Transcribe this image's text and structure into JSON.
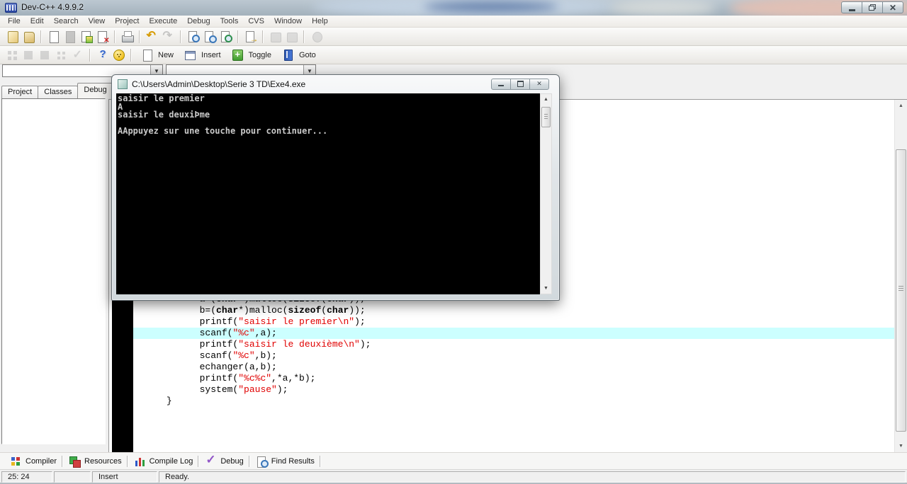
{
  "window": {
    "title": "Dev-C++ 4.9.9.2"
  },
  "menu": {
    "items": [
      "File",
      "Edit",
      "Search",
      "View",
      "Project",
      "Execute",
      "Debug",
      "Tools",
      "CVS",
      "Window",
      "Help"
    ]
  },
  "toolbar": {
    "row1": [
      {
        "icon": "new-project"
      },
      {
        "icon": "open-project"
      },
      "sep",
      {
        "icon": "new-source-file"
      },
      {
        "icon": "save",
        "disabled": true
      },
      {
        "icon": "save-all"
      },
      {
        "icon": "close-file"
      },
      "sep",
      {
        "icon": "print"
      },
      "sep",
      {
        "icon": "undo"
      },
      {
        "icon": "redo",
        "disabled": true
      },
      "sep",
      {
        "icon": "find"
      },
      {
        "icon": "find-in-files"
      },
      {
        "icon": "replace"
      },
      "sep",
      {
        "icon": "goto-line"
      },
      "sep",
      {
        "icon": "compile",
        "disabled": true
      },
      {
        "icon": "run",
        "disabled": true
      },
      "sep",
      {
        "icon": "profile",
        "disabled": true
      }
    ],
    "row2": [
      {
        "icon": "grid-squares",
        "disabled": true
      },
      {
        "icon": "square-a",
        "disabled": true
      },
      {
        "icon": "square-b",
        "disabled": true
      },
      {
        "icon": "grid-small",
        "disabled": true
      },
      {
        "icon": "check",
        "disabled": true
      },
      "sep",
      {
        "icon": "help"
      },
      {
        "icon": "about"
      },
      "sep",
      {
        "icon": "page",
        "label": "New"
      },
      {
        "icon": "insert-win",
        "label": "Insert"
      },
      {
        "icon": "toggle-plus",
        "label": "Toggle"
      },
      {
        "icon": "goto-book",
        "label": "Goto"
      }
    ]
  },
  "combos": {
    "class_combo_value": "",
    "member_combo_value": ""
  },
  "sidebar": {
    "tabs": [
      "Project",
      "Classes",
      "Debug"
    ],
    "active_tab": "Debug"
  },
  "console": {
    "title": "C:\\Users\\Admin\\Desktop\\Serie 3 TD\\Exe4.exe",
    "lines": [
      "saisir le premier",
      "A",
      "saisir le deuxiÞme",
      "",
      "AAppuyez sur une touche pour continuer..."
    ]
  },
  "editor": {
    "highlight_index": 3,
    "lines": [
      {
        "indent": 12,
        "tokens": [
          {
            "t": "p",
            "v": "a=("
          },
          {
            "t": "k",
            "v": "char"
          },
          {
            "t": "p",
            "v": "*)malloc("
          },
          {
            "t": "k",
            "v": "sizeof"
          },
          {
            "t": "p",
            "v": "("
          },
          {
            "t": "k",
            "v": "char"
          },
          {
            "t": "p",
            "v": "));"
          }
        ]
      },
      {
        "indent": 12,
        "tokens": [
          {
            "t": "p",
            "v": "b=("
          },
          {
            "t": "k",
            "v": "char"
          },
          {
            "t": "p",
            "v": "*)malloc("
          },
          {
            "t": "k",
            "v": "sizeof"
          },
          {
            "t": "p",
            "v": "("
          },
          {
            "t": "k",
            "v": "char"
          },
          {
            "t": "p",
            "v": "));"
          }
        ]
      },
      {
        "indent": 12,
        "tokens": [
          {
            "t": "p",
            "v": "printf("
          },
          {
            "t": "s",
            "v": "\"saisir le premier\\n\""
          },
          {
            "t": "p",
            "v": ");"
          }
        ]
      },
      {
        "indent": 12,
        "tokens": [
          {
            "t": "p",
            "v": "scanf("
          },
          {
            "t": "s",
            "v": "\"%c\""
          },
          {
            "t": "p",
            "v": ",a);"
          }
        ]
      },
      {
        "indent": 12,
        "tokens": [
          {
            "t": "p",
            "v": "printf("
          },
          {
            "t": "s",
            "v": "\"saisir le deuxième\\n\""
          },
          {
            "t": "p",
            "v": ");"
          }
        ]
      },
      {
        "indent": 12,
        "tokens": [
          {
            "t": "p",
            "v": "scanf("
          },
          {
            "t": "s",
            "v": "\"%c\""
          },
          {
            "t": "p",
            "v": ",b);"
          }
        ]
      },
      {
        "indent": 12,
        "tokens": [
          {
            "t": "p",
            "v": "echanger(a,b);"
          }
        ]
      },
      {
        "indent": 12,
        "tokens": [
          {
            "t": "p",
            "v": "printf("
          },
          {
            "t": "s",
            "v": "\"%c%c\""
          },
          {
            "t": "p",
            "v": ",*a,*b);"
          }
        ]
      },
      {
        "indent": 12,
        "tokens": [
          {
            "t": "p",
            "v": "system("
          },
          {
            "t": "s",
            "v": "\"pause\""
          },
          {
            "t": "p",
            "v": ");"
          }
        ]
      },
      {
        "indent": 6,
        "tokens": [
          {
            "t": "p",
            "v": "}"
          }
        ]
      }
    ],
    "colors": {
      "string": "#e00000",
      "plain": "#000000",
      "keyword": "#000000",
      "highlight_line": "#ccffff",
      "gutter": "#000000"
    }
  },
  "report_tabs": [
    {
      "label": "Compiler",
      "icon": "compiler"
    },
    {
      "label": "Resources",
      "icon": "resources"
    },
    {
      "label": "Compile Log",
      "icon": "compile-log"
    },
    {
      "label": "Debug",
      "icon": "debug-check"
    },
    {
      "label": "Find Results",
      "icon": "find-results"
    }
  ],
  "statusbar": {
    "caret_position": "25: 24",
    "panel2": "",
    "mode": "Insert",
    "status": "Ready."
  }
}
